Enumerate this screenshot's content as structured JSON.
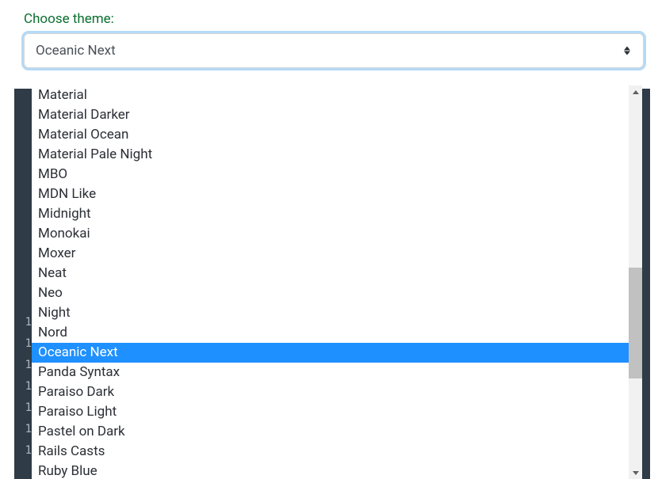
{
  "label": "Choose theme:",
  "selected_value": "Oceanic Next",
  "gutter_lines": [
    "1",
    "1",
    "1",
    "1",
    "1",
    "1",
    "1"
  ],
  "options": [
    {
      "label": "Material",
      "selected": false
    },
    {
      "label": "Material Darker",
      "selected": false
    },
    {
      "label": "Material Ocean",
      "selected": false
    },
    {
      "label": "Material Pale Night",
      "selected": false
    },
    {
      "label": "MBO",
      "selected": false
    },
    {
      "label": "MDN Like",
      "selected": false
    },
    {
      "label": "Midnight",
      "selected": false
    },
    {
      "label": "Monokai",
      "selected": false
    },
    {
      "label": "Moxer",
      "selected": false
    },
    {
      "label": "Neat",
      "selected": false
    },
    {
      "label": "Neo",
      "selected": false
    },
    {
      "label": "Night",
      "selected": false
    },
    {
      "label": "Nord",
      "selected": false
    },
    {
      "label": "Oceanic Next",
      "selected": true
    },
    {
      "label": "Panda Syntax",
      "selected": false
    },
    {
      "label": "Paraiso Dark",
      "selected": false
    },
    {
      "label": "Paraiso Light",
      "selected": false
    },
    {
      "label": "Pastel on Dark",
      "selected": false
    },
    {
      "label": "Rails Casts",
      "selected": false
    },
    {
      "label": "Ruby Blue",
      "selected": false
    }
  ]
}
